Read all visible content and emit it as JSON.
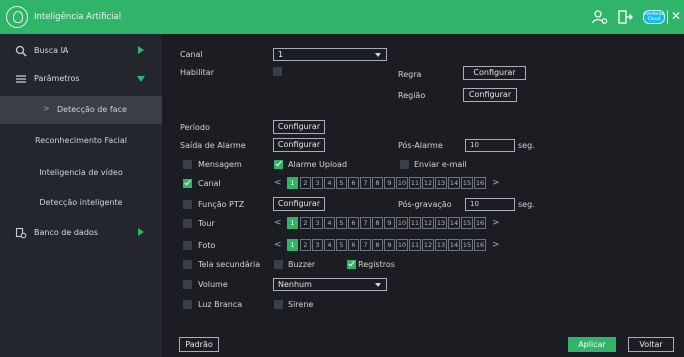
{
  "header": {
    "title": "Inteligência Artificial",
    "cloud_badge": "Intelbras Cloud",
    "close_glyph": "✕"
  },
  "sidebar": {
    "items": [
      {
        "label": "Busca IA",
        "icon": "face-search-icon"
      },
      {
        "label": "Parâmetros",
        "icon": "list-icon"
      },
      {
        "label": "Banco de dados",
        "icon": "database-icon"
      }
    ],
    "sub_items": [
      {
        "label": "Detecção de face",
        "chevron": ">"
      },
      {
        "label": "Reconhecimento Facial"
      },
      {
        "label": "Inteligencia de vídeo"
      },
      {
        "label": "Detecção inteligente"
      }
    ]
  },
  "form": {
    "canal_label": "Canal",
    "canal_value": "1",
    "habilitar_label": "Habilitar",
    "regra_label": "Regra",
    "regiao_label": "Região",
    "configurar": "Configurar",
    "periodo_label": "Período",
    "saida_label": "Saída de Alarme",
    "pos_alarme_label": "Pós-Alarme",
    "pos_alarme_value": "10",
    "seg": "seg.",
    "mensagem": "Mensagem",
    "alarme_upload": "Alarme Upload",
    "enviar_email": "Enviar e-mail",
    "canal_cb": "Canal",
    "funcao_ptz": "Função PTZ",
    "pos_gravacao_label": "Pós-gravação",
    "pos_gravacao_value": "10",
    "tour": "Tour",
    "foto": "Foto",
    "tela_secundaria": "Tela secundária",
    "buzzer": "Buzzer",
    "registros": "Registros",
    "volume": "Volume",
    "volume_value": "Nenhum",
    "luz_branca": "Luz Branca",
    "sirene": "Sirene",
    "pager_prev": "<",
    "pager_next": ">",
    "pages": [
      "1",
      "2",
      "3",
      "4",
      "5",
      "6",
      "7",
      "8",
      "9",
      "10",
      "11",
      "12",
      "13",
      "14",
      "15",
      "16"
    ]
  },
  "footer": {
    "padrao": "Padrão",
    "aplicar": "Aplicar",
    "voltar": "Voltar"
  },
  "colors": {
    "accent": "#2fb46a",
    "background": "#1b1d22",
    "sidebar": "#23262c",
    "cloud": "#19b9e8"
  }
}
